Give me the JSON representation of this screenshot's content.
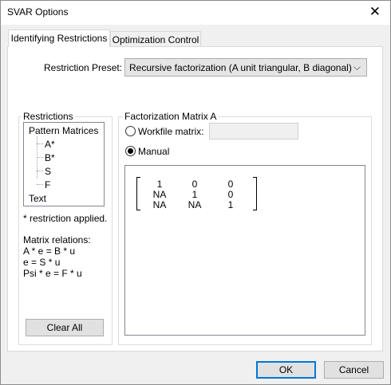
{
  "window": {
    "title": "SVAR Options",
    "close_glyph": "✕"
  },
  "tabs": [
    {
      "label": "Identifying Restrictions",
      "active": true
    },
    {
      "label": "Optimization Control",
      "active": false
    }
  ],
  "preset": {
    "label": "Restriction Preset:",
    "value": "Recursive factorization (A unit triangular, B diagonal)",
    "arrow": "⌵"
  },
  "restrictions": {
    "group_title": "Restrictions",
    "tree": {
      "root": "Pattern Matrices",
      "children": [
        "A*",
        "B*",
        "S",
        "F"
      ],
      "text_item": "Text"
    },
    "note": "* restriction applied.",
    "relations_title": "Matrix relations:",
    "relations": [
      "A * e = B * u",
      "e = S * u",
      "Psi * e = F * u"
    ],
    "clear_all": "Clear All"
  },
  "factorization": {
    "group_title": "Factorization Matrix A",
    "workfile_label": "Workfile matrix:",
    "workfile_value": "",
    "manual_label": "Manual",
    "selected": "manual",
    "matrix": [
      [
        "1",
        "0",
        "0"
      ],
      [
        "NA",
        "1",
        "0"
      ],
      [
        "NA",
        "NA",
        "1"
      ]
    ]
  },
  "buttons": {
    "ok": "OK",
    "cancel": "Cancel"
  }
}
